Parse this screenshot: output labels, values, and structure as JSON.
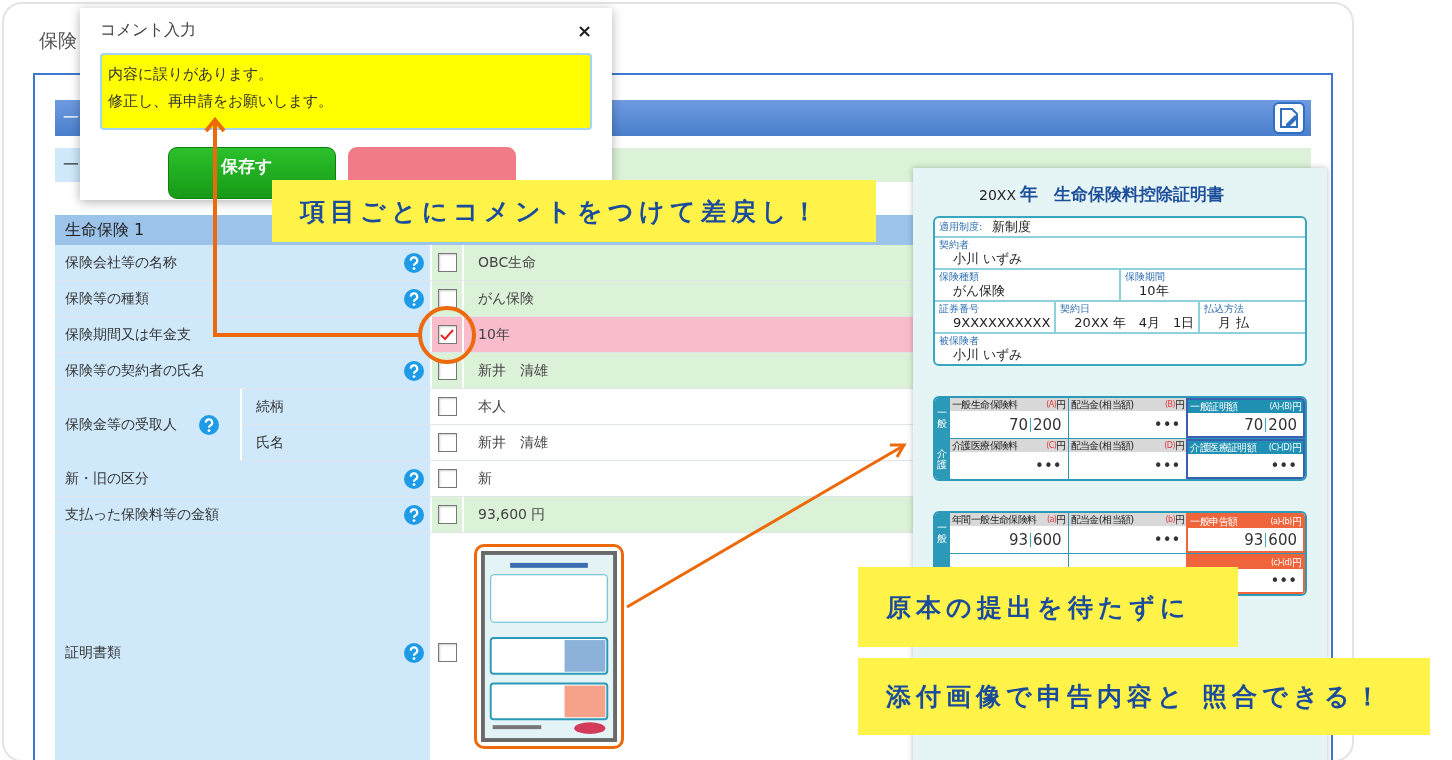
{
  "page_title": "保険",
  "header_bar": {
    "title": "一"
  },
  "sub_bar": {
    "title": "一"
  },
  "section": {
    "title": "生命保険 1"
  },
  "rows": [
    {
      "kind": "field",
      "label": "保険会社等の名称",
      "help": true,
      "checked": false,
      "shaded": true,
      "flagged": false,
      "value": "OBC生命"
    },
    {
      "kind": "field",
      "label": "保険等の種類",
      "help": true,
      "checked": false,
      "shaded": true,
      "flagged": false,
      "value": "がん保険"
    },
    {
      "kind": "field",
      "label": "保険期間又は年金支",
      "help": false,
      "checked": true,
      "flagged": true,
      "value": "10年"
    },
    {
      "kind": "field",
      "label": "保険等の契約者の氏名",
      "help": true,
      "checked": false,
      "shaded": true,
      "flagged": false,
      "value": "新井　清雄"
    },
    {
      "kind": "group",
      "label": "保険金等の受取人",
      "help": true,
      "items": [
        {
          "label": "続柄",
          "checked": false,
          "shaded": false,
          "flagged": false,
          "value": "本人"
        },
        {
          "label": "氏名",
          "checked": false,
          "shaded": false,
          "flagged": false,
          "value": "新井　清雄"
        }
      ]
    },
    {
      "kind": "field",
      "label": "新・旧の区分",
      "help": true,
      "checked": false,
      "shaded": false,
      "flagged": false,
      "value": "新"
    },
    {
      "kind": "field",
      "label": "支払った保険料等の金額",
      "help": true,
      "checked": false,
      "shaded": true,
      "flagged": false,
      "value": "93,600 円"
    },
    {
      "kind": "attachment",
      "label": "証明書類",
      "help": true,
      "checked": false,
      "shaded": false,
      "flagged": false
    }
  ],
  "dialog": {
    "title": "コメント入力",
    "close": "×",
    "comment": {
      "lines": [
        "内容に誤りがあります。",
        "修正し、再申請をお願いします。"
      ]
    },
    "buttons": [
      {
        "kind": "primary",
        "label": "保存す"
      },
      {
        "kind": "secondary"
      }
    ]
  },
  "certificate": {
    "year": "20XX",
    "unit": "年",
    "title": "生命保険料控除証明書",
    "info_rows": [
      {
        "cells": [
          {
            "label": "適用制度:",
            "value": "新制度",
            "inline": true
          }
        ]
      },
      {
        "cells": [
          {
            "label": "契約者",
            "value": "小川 いずみ",
            "inline": false
          }
        ]
      },
      {
        "cells": [
          {
            "label": "保険種類",
            "value": "がん保険",
            "inline": false
          },
          {
            "label": "保険期間",
            "value": "10年",
            "inline": false
          }
        ]
      },
      {
        "cells": [
          {
            "label": "証券番号",
            "value": "9XXXXXXXXXX",
            "inline": false
          },
          {
            "label": "契約日",
            "value": "20XX 年　4月　1日",
            "inline": false
          },
          {
            "label": "払込方法",
            "value": "月 払",
            "inline": false
          }
        ]
      },
      {
        "cells": [
          {
            "label": "被保険者",
            "value": "小川 いずみ",
            "inline": false
          }
        ]
      }
    ],
    "tables": [
      {
        "rows": [
          {
            "side": "一般",
            "cells": [
              {
                "kind": "plain",
                "label": "一般生命保険料",
                "mark": "(A)",
                "unit": "円",
                "value": [
                  "70",
                  "200"
                ]
              },
              {
                "kind": "plain",
                "label": "配当金(相当額)",
                "mark": "(B)",
                "unit": "円",
                "value": [
                  "•••"
                ]
              },
              {
                "kind": "blue",
                "label": "一般証明額",
                "mark": "(A)-(B)",
                "unit": "円",
                "value": [
                  "70",
                  "200"
                ]
              }
            ]
          },
          {
            "side": "介護",
            "cells": [
              {
                "kind": "plain",
                "label": "介護医療保険料",
                "mark": "(C)",
                "unit": "円",
                "value": [
                  "•••"
                ]
              },
              {
                "kind": "plain",
                "label": "配当金(相当額)",
                "mark": "(D)",
                "unit": "円",
                "value": [
                  "•••"
                ]
              },
              {
                "kind": "blue",
                "label": "介護医療証明額",
                "mark": "(C)-(D)",
                "unit": "円",
                "value": [
                  "•••"
                ]
              }
            ]
          }
        ]
      },
      {
        "rows": [
          {
            "side": "一般",
            "cells": [
              {
                "kind": "plain",
                "label": "年間一般生命保険料",
                "mark": "(a)",
                "unit": "円",
                "value": [
                  "93",
                  "600"
                ]
              },
              {
                "kind": "plain",
                "label": "配当金(相当額)",
                "mark": "(b)",
                "unit": "円",
                "value": [
                  "•••"
                ]
              },
              {
                "kind": "orange",
                "label": "一般申告額",
                "mark": "(a)-(b)",
                "unit": "円",
                "value": [
                  "93",
                  "600"
                ]
              }
            ]
          },
          {
            "cells": [
              {
                "kind": "hidden"
              },
              {
                "kind": "hidden"
              },
              {
                "kind": "orange",
                "mark": "(c)-(d)",
                "unit": "円",
                "value": [
                  "•••"
                ]
              }
            ]
          }
        ]
      }
    ]
  },
  "callouts": [
    {
      "text": "項目ごとにコメントをつけて差戻し！"
    },
    {
      "text": "原本の提出を待たずに"
    },
    {
      "text": "添付画像で申告内容と 照合できる！"
    }
  ]
}
